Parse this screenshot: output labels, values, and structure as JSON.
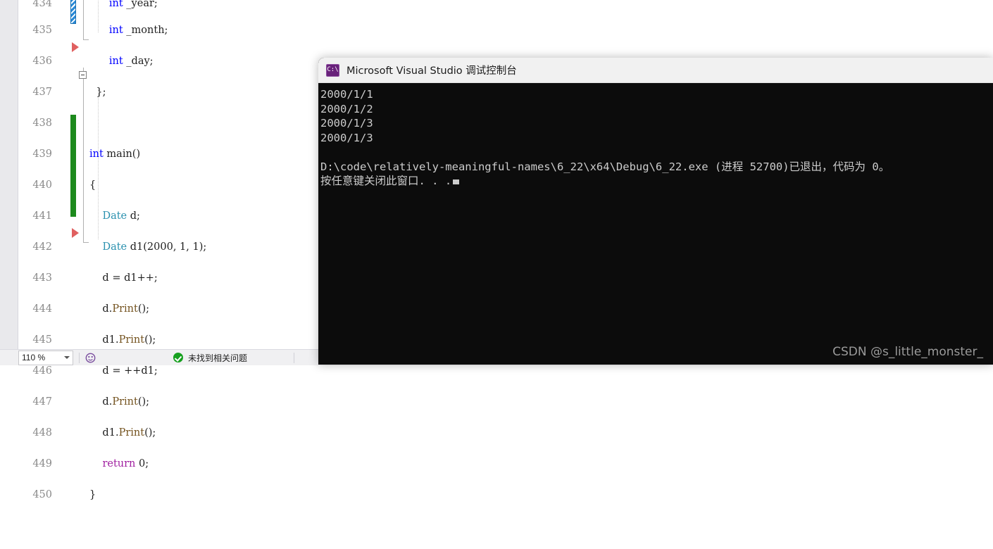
{
  "editor": {
    "name": "visual-studio-code-editor",
    "lines": [
      {
        "num": "434",
        "text": "        int _year;",
        "tokens": [
          {
            "t": "        ",
            "c": "punct"
          },
          {
            "t": "int",
            "c": "kw"
          },
          {
            "t": " _year;",
            "c": "ident"
          }
        ]
      },
      {
        "num": "435",
        "text": "        int _month;",
        "tokens": [
          {
            "t": "        ",
            "c": "punct"
          },
          {
            "t": "int",
            "c": "kw"
          },
          {
            "t": " _month;",
            "c": "ident"
          }
        ]
      },
      {
        "num": "436",
        "text": "        int _day;",
        "tokens": [
          {
            "t": "        ",
            "c": "punct"
          },
          {
            "t": "int",
            "c": "kw"
          },
          {
            "t": " _day;",
            "c": "ident"
          }
        ]
      },
      {
        "num": "437",
        "text": "    };",
        "tokens": [
          {
            "t": "    };",
            "c": "punct"
          }
        ]
      },
      {
        "num": "438",
        "text": "",
        "tokens": []
      },
      {
        "num": "439",
        "text": "int main()",
        "tokens": [
          {
            "t": "int",
            "c": "kw"
          },
          {
            "t": " ",
            "c": "punct"
          },
          {
            "t": "main",
            "c": "ident"
          },
          {
            "t": "()",
            "c": "punct"
          }
        ]
      },
      {
        "num": "440",
        "text": "{",
        "tokens": [
          {
            "t": "{",
            "c": "punct"
          }
        ]
      },
      {
        "num": "441",
        "text": "    Date d;",
        "tokens": [
          {
            "t": "    ",
            "c": "punct"
          },
          {
            "t": "Date",
            "c": "type"
          },
          {
            "t": " d;",
            "c": "ident"
          }
        ]
      },
      {
        "num": "442",
        "text": "    Date d1(2000, 1, 1);",
        "tokens": [
          {
            "t": "    ",
            "c": "punct"
          },
          {
            "t": "Date",
            "c": "type"
          },
          {
            "t": " d1(",
            "c": "ident"
          },
          {
            "t": "2000",
            "c": "num"
          },
          {
            "t": ", ",
            "c": "punct"
          },
          {
            "t": "1",
            "c": "num"
          },
          {
            "t": ", ",
            "c": "punct"
          },
          {
            "t": "1",
            "c": "num"
          },
          {
            "t": ");",
            "c": "punct"
          }
        ]
      },
      {
        "num": "443",
        "text": "    d = d1++;",
        "tokens": [
          {
            "t": "    d = d1++;",
            "c": "ident"
          }
        ]
      },
      {
        "num": "444",
        "text": "    d.Print();",
        "tokens": [
          {
            "t": "    d.",
            "c": "ident"
          },
          {
            "t": "Print",
            "c": "meth"
          },
          {
            "t": "();",
            "c": "punct"
          }
        ]
      },
      {
        "num": "445",
        "text": "    d1.Print();",
        "tokens": [
          {
            "t": "    d1.",
            "c": "ident"
          },
          {
            "t": "Print",
            "c": "meth"
          },
          {
            "t": "();",
            "c": "punct"
          }
        ]
      },
      {
        "num": "446",
        "text": "    d = ++d1;",
        "tokens": [
          {
            "t": "    d = ++d1;",
            "c": "ident"
          }
        ]
      },
      {
        "num": "447",
        "text": "    d.Print();",
        "tokens": [
          {
            "t": "    d.",
            "c": "ident"
          },
          {
            "t": "Print",
            "c": "meth"
          },
          {
            "t": "();",
            "c": "punct"
          }
        ]
      },
      {
        "num": "448",
        "text": "    d1.Print();",
        "tokens": [
          {
            "t": "    d1.",
            "c": "ident"
          },
          {
            "t": "Print",
            "c": "meth"
          },
          {
            "t": "();",
            "c": "punct"
          }
        ]
      },
      {
        "num": "449",
        "text": "    return 0;",
        "tokens": [
          {
            "t": "    ",
            "c": "punct"
          },
          {
            "t": "return",
            "c": "kw2"
          },
          {
            "t": " ",
            "c": "punct"
          },
          {
            "t": "0",
            "c": "num"
          },
          {
            "t": ";",
            "c": "punct"
          }
        ]
      },
      {
        "num": "450",
        "text": "}",
        "tokens": [
          {
            "t": "}",
            "c": "punct"
          }
        ]
      }
    ]
  },
  "status_bar": {
    "zoom_level": "110 %",
    "issues_text": "未找到相关问题"
  },
  "console": {
    "title": "Microsoft Visual Studio 调试控制台",
    "icon": "console-app-icon",
    "output_lines": [
      "2000/1/1",
      "2000/1/2",
      "2000/1/3",
      "2000/1/3",
      "",
      "D:\\code\\relatively-meaningful-names\\6_22\\x64\\Debug\\6_22.exe (进程 52700)已退出，代码为 0。",
      "按任意键关闭此窗口. . ."
    ]
  },
  "watermark": {
    "text": "CSDN @s_little_monster_"
  },
  "colors": {
    "keyword_blue": "#0000ff",
    "type_teal": "#2b91af",
    "method_brown": "#74531f",
    "return_purple": "#a020a0",
    "change_bar_saved": "#1d8a1d",
    "change_bar_unsaved": "#2b8ad6",
    "breakpoint_red": "#e06060",
    "console_bg": "#0c0c0c",
    "console_text": "#cccccc",
    "console_icon_purple": "#68217a"
  }
}
